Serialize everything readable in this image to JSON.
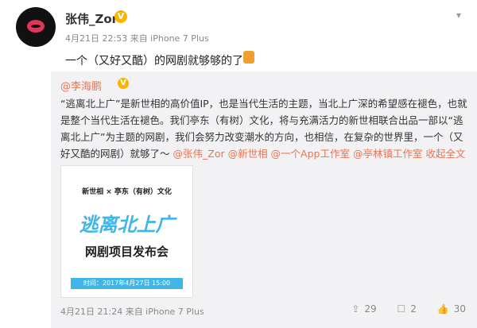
{
  "post": {
    "username": "张伟_Zor",
    "vip_badge": "V",
    "meta": "4月21日 22:53 来自 iPhone 7 Plus",
    "text": "一个（又好又酷）的网剧就够够的了",
    "emoji": "thumbs-up"
  },
  "repost": {
    "username": "@李海鹏",
    "vip_badge": "V",
    "body_plain": "“逃离北上广”是新世相的高价值IP，也是当代生活的主题，当北上广深的希望感在褪色，也就是整个当代生活在褪色。我们亭东（有树）文化，将与充满活力的新世相联合出品一部以“逃离北上广”为主题的网剧，我们会努力改变潮水的方向，也相信，在复杂的世界里，一个（又好又酷的网剧）就够了～",
    "mentions": "@张伟_Zor @新世相 @一个App工作室 @亭林镇工作室",
    "collapse": "收起全文",
    "image": {
      "top_text": "新世相 × 亭东（有树）文化",
      "title": "逃离北上广",
      "subtitle": "网剧项目发布会",
      "bar": "时间：2017年4月27日 15:00"
    },
    "meta": "4月21日 21:24 来自 iPhone 7 Plus",
    "actions": {
      "share": "29",
      "comment": "2",
      "like": "30"
    }
  }
}
